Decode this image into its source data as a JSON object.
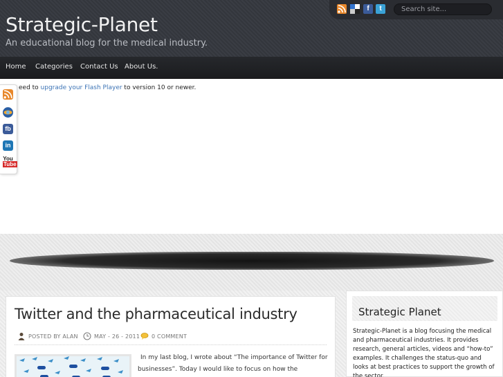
{
  "header": {
    "title": "Strategic-Planet",
    "tagline": "An educational blog for the medical industry.",
    "search_placeholder": "Search site..."
  },
  "nav": {
    "items": [
      "Home",
      "Categories",
      "Contact Us",
      "About Us."
    ]
  },
  "flash": {
    "prefix": "eed to ",
    "link": "upgrade your Flash Player",
    "suffix": " to version 10 or newer."
  },
  "social_top": [
    "rss-icon",
    "delicious-icon",
    "facebook-icon",
    "twitter-icon"
  ],
  "social_side": [
    "rss-icon",
    "globe-icon",
    "facebook-icon",
    "linkedin-icon",
    "youtube-icon"
  ],
  "post": {
    "title": "Twitter and the pharmaceutical industry",
    "author": "POSTED BY ALAN",
    "date": "MAY - 26 - 2011",
    "comments": "0 COMMENT",
    "excerpt_line1": "In my last blog, I wrote about “The importance of Twitter for",
    "excerpt_line2": "businesses”. Today I would like to focus on how the pharmaceutical"
  },
  "sidebar": {
    "title": "Strategic Planet",
    "text": "Strategic-Planet is a blog focusing the medical and pharmaceutical industries. It provides research, general articles, videos and “how-to” examples. It challenges the status-quo and looks at best practices to support the growth of the sector."
  },
  "colors": {
    "header_bg": "#383b42",
    "nav_bg": "#1f2124",
    "link": "#3d74b6"
  }
}
